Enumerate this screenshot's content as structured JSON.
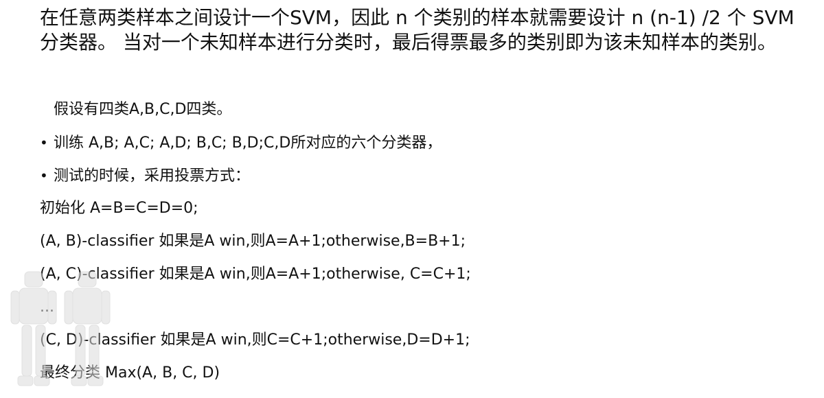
{
  "intro": "在任意两类样本之间设计一个SVM，因此 n 个类别的样本就需要设计 n (n-1) /2 个 SVM分类器。 当对一个未知样本进行分类时，最后得票最多的类别即为该未知样本的类别。",
  "lines": [
    {
      "bullet": "",
      "text": "假设有四类A,B,C,D四类。"
    },
    {
      "bullet": "•",
      "text": "训练 A,B; A,C; A,D; B,C; B,D;C,D所对应的六个分类器，"
    },
    {
      "bullet": "•",
      "text": "测试的时候，采用投票方式："
    },
    {
      "bullet": "",
      "text": "初始化 A=B=C=D=0;"
    },
    {
      "bullet": "",
      "text": "(A, B)-classifier 如果是A win,则A=A+1;otherwise,B=B+1;"
    },
    {
      "bullet": "",
      "text": "(A, C)-classifier 如果是A win,则A=A+1;otherwise, C=C+1;"
    },
    {
      "bullet": "",
      "text": "..."
    },
    {
      "bullet": "",
      "text": "(C, D)-classifier 如果是A win,则C=C+1;otherwise,D=D+1;"
    },
    {
      "bullet": "",
      "text": "最终分类 Max(A, B, C, D)"
    }
  ],
  "watermark_icon": "robot-figures-icon",
  "colors": {
    "text": "#111111",
    "watermark": "#d8d8d8"
  }
}
